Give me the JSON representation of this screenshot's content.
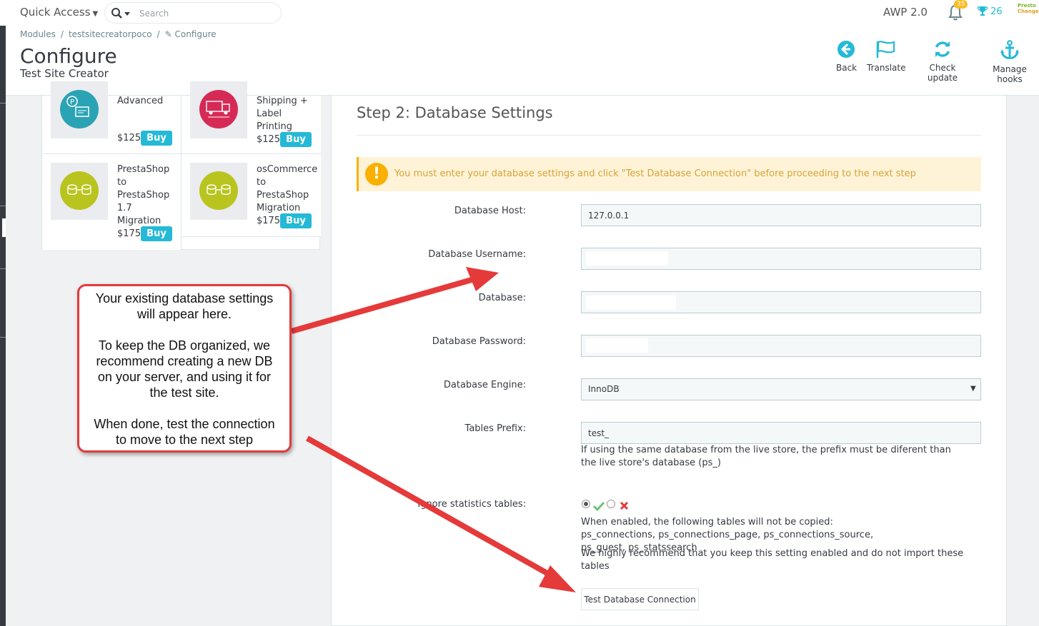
{
  "topbar": {
    "quick_access": "Quick Access",
    "search_placeholder": "Search",
    "shop_name": "AWP 2.0",
    "notification_count": "35",
    "trophy_count": "26",
    "brand_logo_text": "PrestoChange"
  },
  "header": {
    "breadcrumb": [
      "Modules",
      "testsitecreatorpoco",
      "Configure"
    ],
    "title": "Configure",
    "subtitle": "Test Site Creator",
    "toolbar": [
      {
        "label": "Back",
        "icon": "back-circle-icon"
      },
      {
        "label": "Translate",
        "icon": "flag-icon"
      },
      {
        "label": "Check update",
        "icon": "refresh-icon"
      },
      {
        "label": "Manage hooks",
        "icon": "anchor-icon"
      }
    ]
  },
  "modules": [
    {
      "name_lines": [
        "Advanced"
      ],
      "price": "$125",
      "buy": "Buy",
      "color": "#2aa3b4"
    },
    {
      "name_lines": [
        "Shipping +",
        "Label",
        "Printing"
      ],
      "price": "$125",
      "buy": "Buy",
      "color": "#d62a56"
    },
    {
      "name_lines": [
        "PrestaShop",
        "to",
        "PrestaShop",
        "1.7",
        "Migration"
      ],
      "price": "$175",
      "buy": "Buy",
      "color": "#b9c41f"
    },
    {
      "name_lines": [
        "osCommerce",
        "to",
        "PrestaShop",
        "Migration"
      ],
      "price": "$175",
      "buy": "Buy",
      "color": "#b9c41f"
    }
  ],
  "form": {
    "step_title": "Step 2: Database Settings",
    "warning": "You must enter your database settings and click \"Test Database Connection\" before proceeding to the next step",
    "fields": {
      "host": {
        "label": "Database Host:",
        "value": "127.0.0.1"
      },
      "username": {
        "label": "Database Username:",
        "value": ""
      },
      "database": {
        "label": "Database:",
        "value": ""
      },
      "password": {
        "label": "Database Password:",
        "value": ""
      },
      "engine": {
        "label": "Database Engine:",
        "value": "InnoDB"
      },
      "prefix": {
        "label": "Tables Prefix:",
        "value": "test_",
        "help": "If using the same database from the live store, the prefix must be diferent than the live store's database (ps_)"
      },
      "ignore_stats": {
        "label": "Ignore statistics tables:",
        "selected": "yes",
        "help1": "When enabled, the following tables will not be copied: ps_connections, ps_connections_page, ps_connections_source, ps_guest, ps_statssearch",
        "help2": "We highly recommend that you keep this setting enabled and do not import these tables"
      }
    },
    "test_button": "Test Database Connection"
  },
  "callout": {
    "paragraphs": [
      [
        "Your existing database settings",
        "will appear here."
      ],
      [
        "To keep the DB organized, we",
        "recommend creating a new DB",
        "on your server, and using it for",
        "the test site."
      ],
      [
        "When done, test the connection",
        "to move to the next step"
      ]
    ]
  },
  "colors": {
    "accent": "#25b9d7",
    "warning_bg": "#fff3d7",
    "warning_text": "#d5a43a",
    "callout_border": "#e23a3a"
  }
}
